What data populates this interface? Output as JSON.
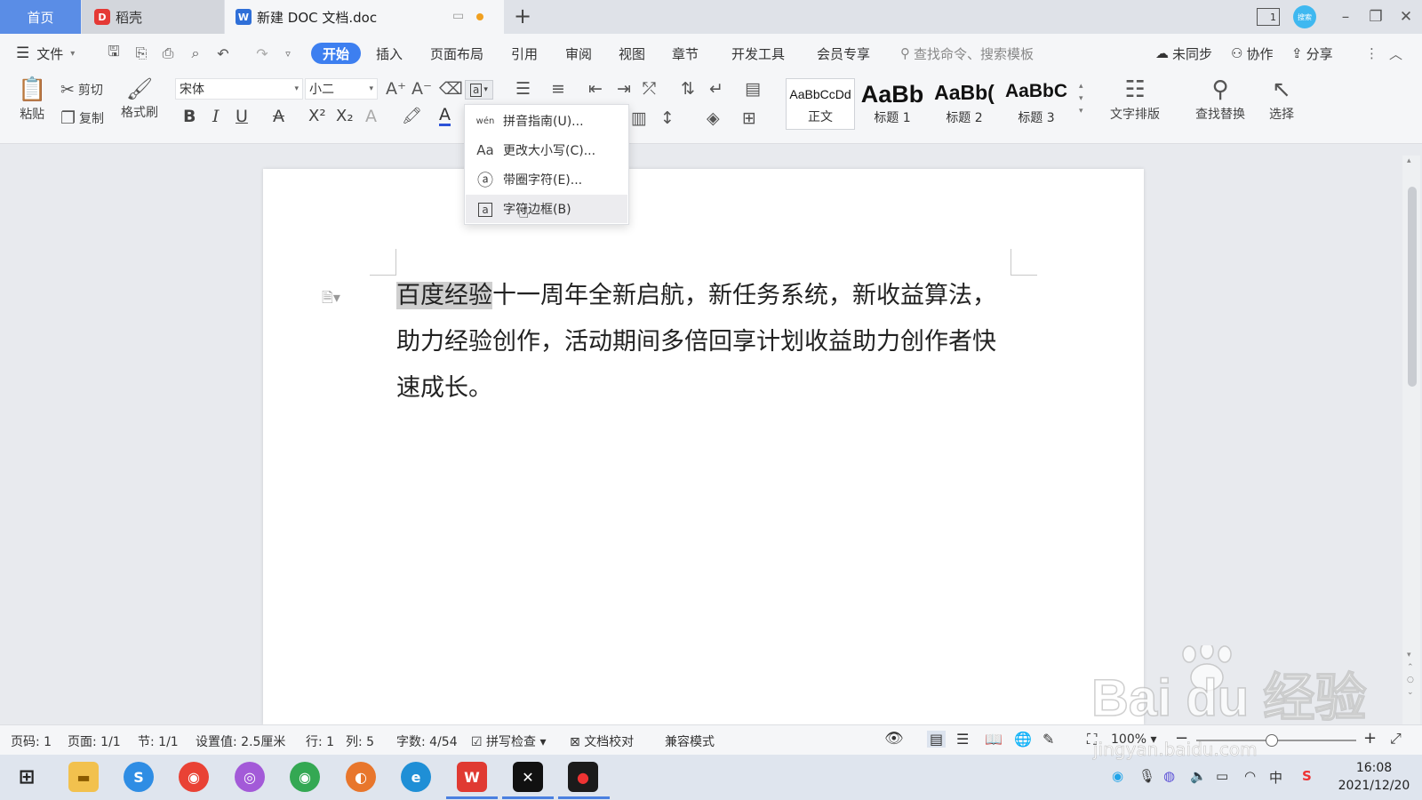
{
  "tabs": {
    "home": "首页",
    "daoke": "稻壳",
    "doc": "新建 DOC 文档.doc",
    "new_tab": "+"
  },
  "window": {
    "badge": "1",
    "avatar": "搜索"
  },
  "menu": {
    "file": "文件",
    "items": [
      "开始",
      "插入",
      "页面布局",
      "引用",
      "审阅",
      "视图",
      "章节",
      "开发工具",
      "会员专享"
    ],
    "search_placeholder": "查找命令、搜索模板",
    "sync": "未同步",
    "collab": "协作",
    "share": "分享"
  },
  "toolbar": {
    "paste": "粘贴",
    "cut": "剪切",
    "copy": "复制",
    "format_painter": "格式刷",
    "font_name": "宋体",
    "font_size": "小二",
    "styles": [
      {
        "preview": "AaBbCcDd",
        "label": "正文"
      },
      {
        "preview": "AaBb",
        "label": "标题 1"
      },
      {
        "preview": "AaBb(",
        "label": "标题 2"
      },
      {
        "preview": "AaBbC",
        "label": "标题 3"
      }
    ],
    "text_layout": "文字排版",
    "find_replace": "查找替换",
    "select": "选择"
  },
  "dropdown": {
    "items": [
      {
        "icon": "wén",
        "label": "拼音指南(U)..."
      },
      {
        "icon": "Aa",
        "label": "更改大小写(C)..."
      },
      {
        "icon": "ⓐ",
        "label": "带圈字符(E)..."
      },
      {
        "icon": "a",
        "label": "字符边框(B)"
      }
    ]
  },
  "document": {
    "selected_text": "百度经验",
    "rest_text": "十一周年全新启航，新任务系统，新收益算法，助力经验创作，活动期间多倍回享计划收益助力创作者快速成长。"
  },
  "status": {
    "page_num": "页码: 1",
    "page": "页面: 1/1",
    "section": "节: 1/1",
    "setting": "设置值: 2.5厘米",
    "row": "行: 1",
    "col": "列: 5",
    "words": "字数: 4/54",
    "spell": "拼写检查",
    "proof": "文档校对",
    "compat": "兼容模式",
    "zoom": "100%"
  },
  "taskbar": {
    "time": "16:08",
    "date": "2021/12/20",
    "ime": "中"
  },
  "watermark": {
    "logo": "Bai  du 经验",
    "url": "jingyan.baidu.com"
  },
  "colors": {
    "accent": "#3d7ff0",
    "home_tab": "#5a8de6",
    "selection": "#cfcfcf"
  }
}
